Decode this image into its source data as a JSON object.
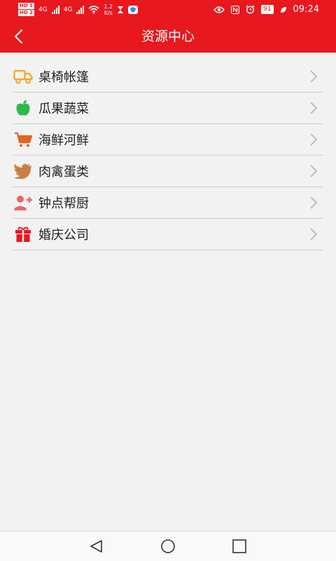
{
  "status_bar": {
    "hd1": "HD 1",
    "hd2": "HD 2",
    "net1": "4G",
    "net2": "4G",
    "speed_value": "1.2",
    "speed_unit": "K/s",
    "battery": "91",
    "time": "09:24"
  },
  "header": {
    "title": "资源中心",
    "back_icon": "chevron-left-icon"
  },
  "menu": {
    "items": [
      {
        "label": "桌椅帐篷",
        "icon": "truck-icon",
        "color": "#f5a623"
      },
      {
        "label": "瓜果蔬菜",
        "icon": "apple-icon",
        "color": "#2fb84a"
      },
      {
        "label": "海鲜河鲜",
        "icon": "cart-icon",
        "color": "#e8631f"
      },
      {
        "label": "肉禽蛋类",
        "icon": "bird-icon",
        "color": "#c88046"
      },
      {
        "label": "钟点帮厨",
        "icon": "add-user-icon",
        "color": "#ee6464"
      },
      {
        "label": "婚庆公司",
        "icon": "gift-icon",
        "color": "#e8181f"
      }
    ],
    "chevron_icon": "chevron-right-icon"
  },
  "nav_bar": {
    "back": "triangle-back-icon",
    "home": "circle-home-icon",
    "recents": "square-recents-icon"
  },
  "colors": {
    "primary": "#e8181f",
    "background": "#f2f2f2"
  }
}
